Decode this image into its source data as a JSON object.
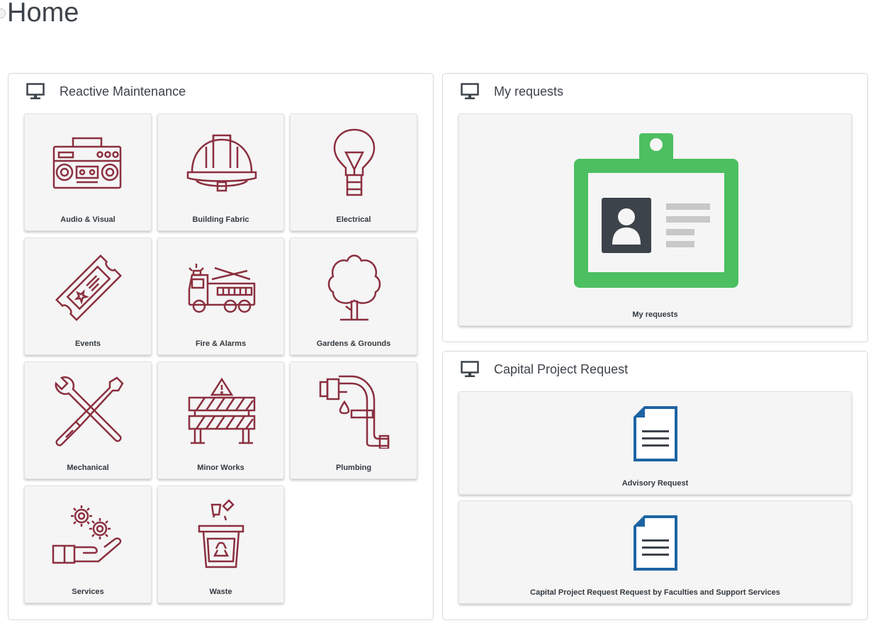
{
  "page": {
    "title": "Home"
  },
  "reactive": {
    "title": "Reactive Maintenance",
    "tiles": [
      {
        "label": "Audio & Visual",
        "icon": "radio-icon"
      },
      {
        "label": "Building Fabric",
        "icon": "hard-hat-icon"
      },
      {
        "label": "Electrical",
        "icon": "light-bulb-icon"
      },
      {
        "label": "Events",
        "icon": "ticket-icon"
      },
      {
        "label": "Fire & Alarms",
        "icon": "fire-truck-icon"
      },
      {
        "label": "Gardens & Grounds",
        "icon": "tree-icon"
      },
      {
        "label": "Mechanical",
        "icon": "tools-icon"
      },
      {
        "label": "Minor Works",
        "icon": "barrier-icon"
      },
      {
        "label": "Plumbing",
        "icon": "pipe-icon"
      },
      {
        "label": "Services",
        "icon": "gears-hand-icon"
      },
      {
        "label": "Waste",
        "icon": "recycle-bin-icon"
      }
    ]
  },
  "my_requests": {
    "title": "My requests",
    "tile_label": "My requests",
    "icon": "id-badge-icon"
  },
  "capital": {
    "title": "Capital Project Request",
    "tiles": [
      {
        "label": "Advisory Request",
        "icon": "document-icon"
      },
      {
        "label": "Capital Project Request Request by Faculties and Support Services",
        "icon": "document-icon"
      }
    ]
  },
  "colors": {
    "icon_maroon": "#8b2f3f",
    "badge_green": "#4cbf61",
    "badge_dark": "#3d434b",
    "document_blue": "#1e64a3"
  }
}
